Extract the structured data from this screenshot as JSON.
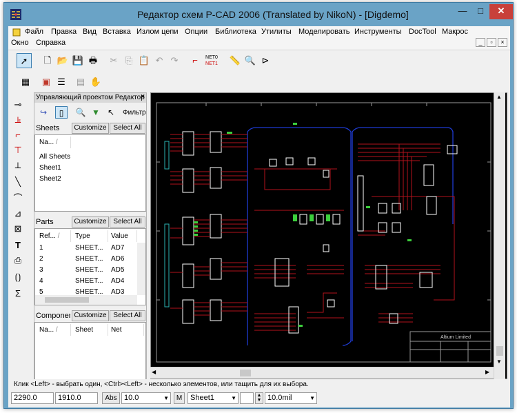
{
  "window": {
    "title": "Редактор схем P-CAD 2006 (Translated by NikoN) - [Digdemo]",
    "btn_min": "—",
    "btn_max": "□",
    "btn_close": "✕"
  },
  "menu": {
    "items": [
      "Файл",
      "Правка",
      "Вид",
      "Вставка",
      "Излом цепи",
      "Опции",
      "Библиотека",
      "Утилиты",
      "Моделировать",
      "Инструменты",
      "DocTool",
      "Макрос"
    ],
    "row2": [
      "Окно",
      "Справка"
    ]
  },
  "toolbar": {
    "net_top": "NET0",
    "net_bottom": "NET1"
  },
  "panel": {
    "title": "Управляющий проектом Редактор",
    "filter_label": "Фильтр",
    "sheets": {
      "label": "Sheets",
      "customize": "Customize",
      "select_all": "Select All",
      "col_name": "Na...",
      "items": [
        "All Sheets",
        "Sheet1",
        "Sheet2"
      ]
    },
    "parts": {
      "label": "Parts",
      "customize": "Customize",
      "select_all": "Select All",
      "cols": [
        "Ref...",
        "Type",
        "Value"
      ],
      "rows": [
        {
          "ref": "1",
          "type": "SHEET...",
          "value": "AD7"
        },
        {
          "ref": "2",
          "type": "SHEET...",
          "value": "AD6"
        },
        {
          "ref": "3",
          "type": "SHEET...",
          "value": "AD5"
        },
        {
          "ref": "4",
          "type": "SHEET...",
          "value": "AD4"
        },
        {
          "ref": "5",
          "type": "SHEET...",
          "value": "AD3"
        }
      ]
    },
    "components": {
      "label": "Componen",
      "customize": "Customize",
      "select_all": "Select All",
      "cols": [
        "Na...",
        "Sheet",
        "Net"
      ]
    }
  },
  "canvas": {
    "title_block_text": "Altium Limited"
  },
  "status": {
    "hint": "Клик <Left> - выбрать один, <Ctrl><Left> - несколько элементов, или тащить для их выбора.",
    "x": "2290.0",
    "y": "1910.0",
    "abs": "Abs",
    "grid": "10.0",
    "m": "M",
    "sheet": "Sheet1",
    "line_width": "10.0mil"
  },
  "colors": {
    "wire": "#b3121c",
    "bus": "#1e3bd1",
    "component": "#ffffff",
    "pin_green": "#3ccf3c",
    "frame": "#9a9a9a"
  }
}
